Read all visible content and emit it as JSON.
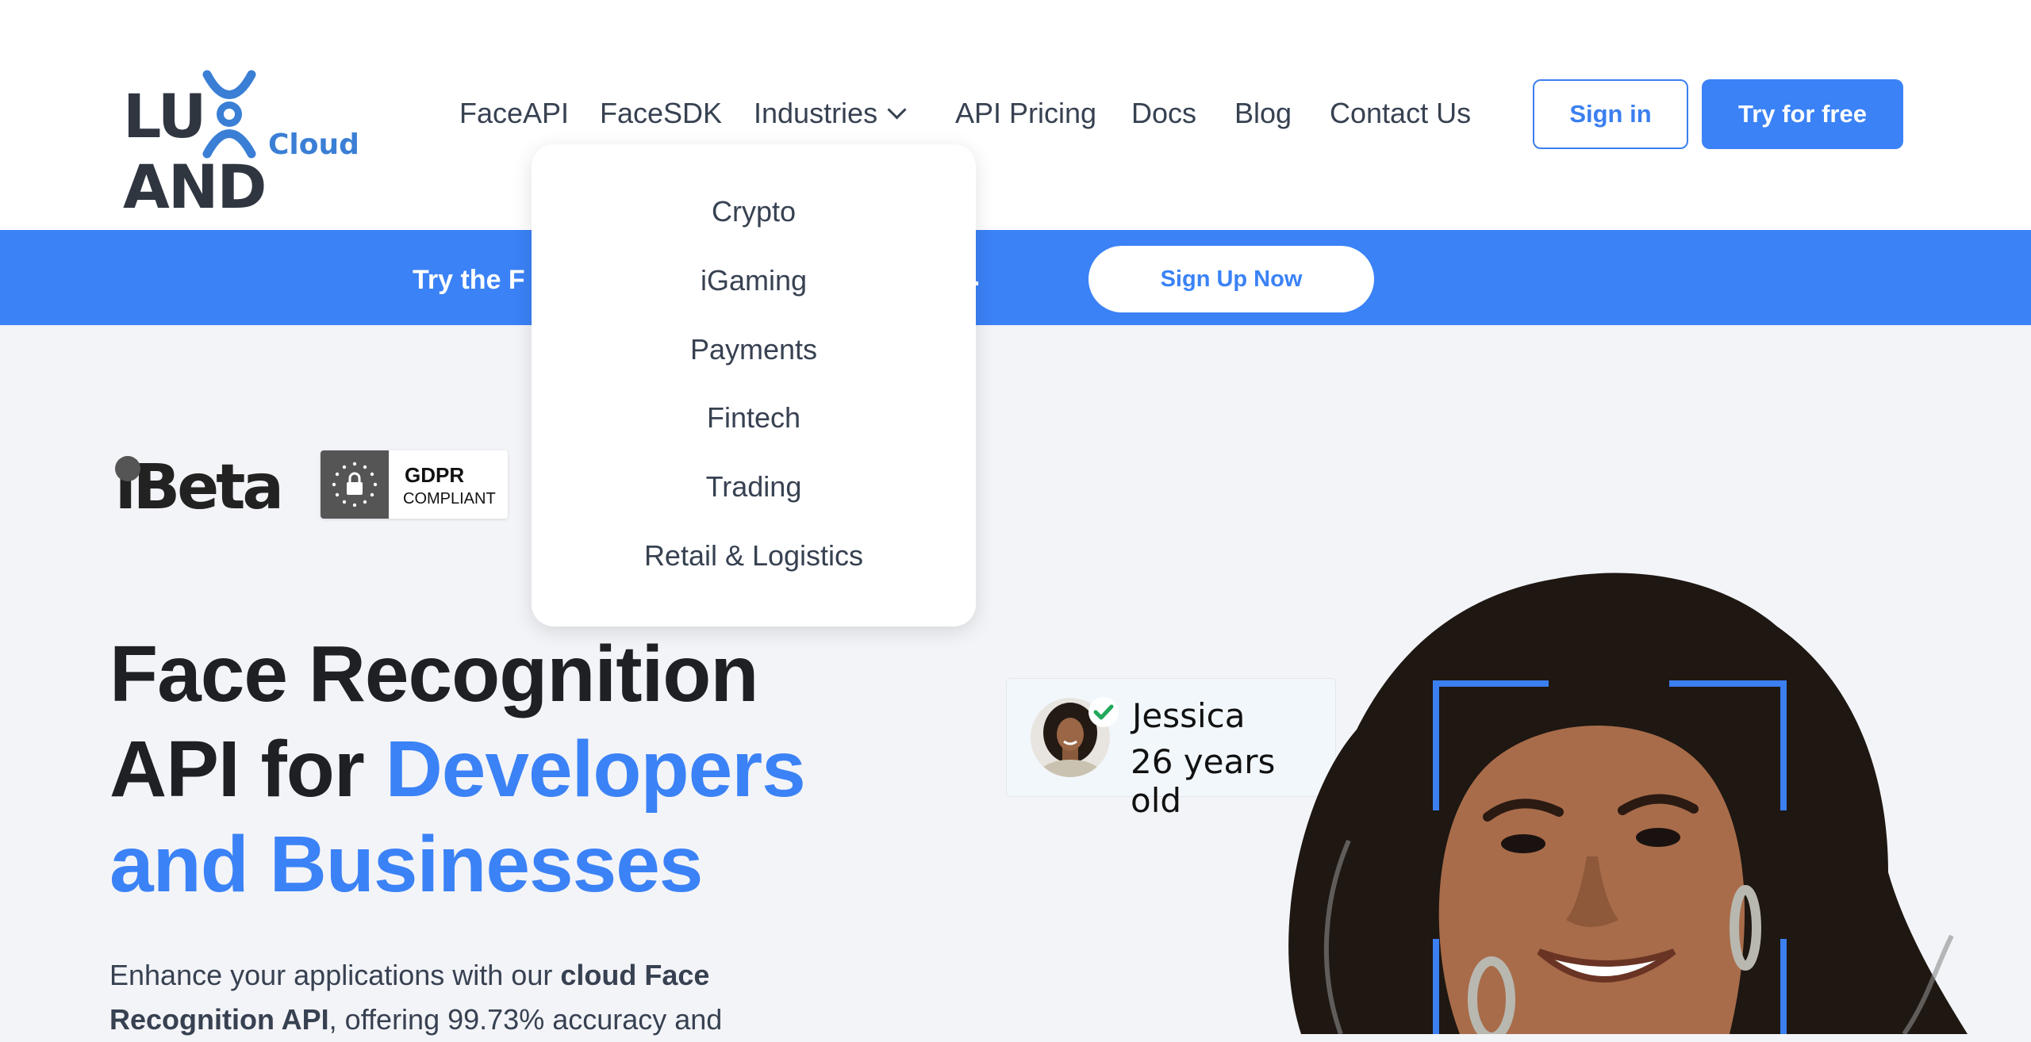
{
  "logo": {
    "wordmark_left": "LU",
    "wordmark_right": "AND",
    "sub": "Cloud"
  },
  "nav": {
    "items": [
      {
        "label": "FaceAPI"
      },
      {
        "label": "FaceSDK"
      },
      {
        "label": "Industries"
      },
      {
        "label": "API Pricing"
      },
      {
        "label": "Docs"
      },
      {
        "label": "Blog"
      },
      {
        "label": "Contact Us"
      }
    ],
    "sign_in": "Sign in",
    "try_free": "Try for free"
  },
  "banner": {
    "text": "Try the F",
    "text_end": ".",
    "button": "Sign Up Now"
  },
  "dropdown": {
    "items": [
      {
        "label": "Crypto"
      },
      {
        "label": "iGaming"
      },
      {
        "label": "Payments"
      },
      {
        "label": "Fintech"
      },
      {
        "label": "Trading"
      },
      {
        "label": "Retail & Logistics"
      }
    ]
  },
  "badges": {
    "ibeta": "iBeta",
    "gdpr_title": "GDPR",
    "gdpr_sub": "COMPLIANT"
  },
  "hero": {
    "line1": "Face Recognition",
    "line2a": "API for ",
    "line2b": "Developers",
    "line3": "and Businesses",
    "lead_a": "Enhance your applications with our ",
    "lead_b": "cloud Face Recognition API",
    "lead_c": ", offering 99.73% accuracy and"
  },
  "person_card": {
    "name": "Jessica",
    "age": "26 years old"
  },
  "colors": {
    "accent": "#3b82f6",
    "text": "#374151",
    "heading": "#1f2023",
    "bg": "#f3f4f8"
  }
}
